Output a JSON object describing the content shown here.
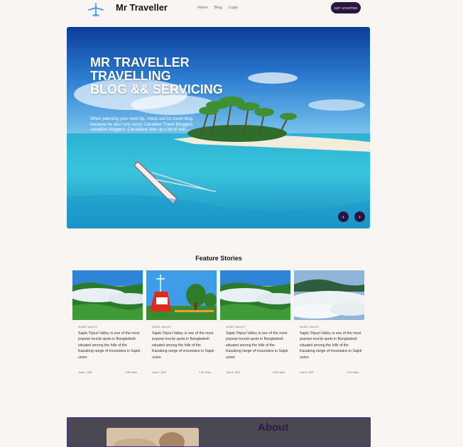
{
  "header": {
    "brand": "Mr Traveller",
    "nav": [
      "Home",
      "Blog",
      "Login"
    ],
    "cta_label": "GET STARTED",
    "logo_icon": "airplane-icon"
  },
  "hero": {
    "title": "MR TRAVELLER\nTRAVELLING\nBLOG && SERVICING",
    "text": "When planning your next trip, check out his travel blog because he also runs tours! Canadian Travel Bloggers canadian bloggers. Canadians take up a lot of real ....",
    "prev_icon": "chevron-left-icon",
    "next_icon": "chevron-right-icon",
    "prev_glyph": "‹",
    "next_glyph": "›"
  },
  "feature": {
    "title": "Feature Stories",
    "cards": [
      {
        "category": "SAJEK VALLEY",
        "description": "Sajek Tripuri Valley is one of the most popular tourist spots in Bangladesh situated among the hills of the Kasalong range of mountains in Sajek union",
        "date": "June 1, 2022",
        "views": "2.3K views"
      },
      {
        "category": "SAJEK VALLEY",
        "description": "Sajek Tripuri Valley is one of the most popular tourist spots in Bangladesh situated among the hills of the Kasalong range of mountains in Sajek union",
        "date": "June 2, 2022",
        "views": "2.2K views"
      },
      {
        "category": "SAJEK VALLEY",
        "description": "Sajek Tripuri Valley is one of the most popular tourist spots in Bangladesh situated among the hills of the Kasalong range of mountains in Sajek union",
        "date": "June 3, 2022",
        "views": "2.3K views"
      },
      {
        "category": "SAJEK VALLEY",
        "description": "Sajek Tripuri Valley is one of the most popular tourist spots in Bangladesh situated among the hills of the Kasalong range of mountains in Sajek union",
        "date": "June 4, 2022",
        "views": "2.4K views"
      }
    ]
  },
  "about": {
    "title": "About"
  },
  "colors": {
    "accent": "#2a1541",
    "background": "#f8f5f3",
    "about_bg": "#4a4853"
  }
}
